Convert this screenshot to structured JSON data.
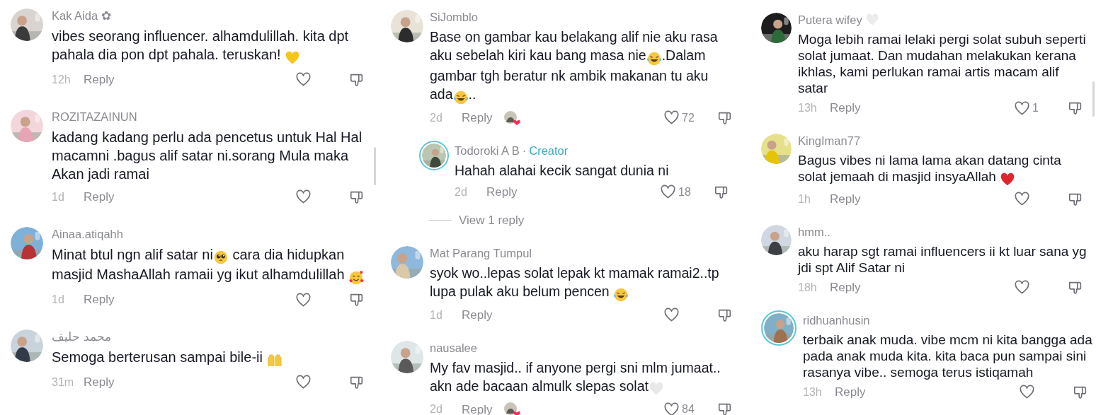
{
  "panels": [
    {
      "comments": [
        {
          "author": "Kak Aida ✿",
          "ring": false,
          "segments": [
            {
              "kind": "text",
              "text": "vibes seorang influencer. alhamdulillah. kita dpt pahala dia pon dpt pahala. teruskan! "
            },
            {
              "kind": "heart_emoji",
              "color": "#f5c518"
            }
          ],
          "time": "12h",
          "reply_label": "Reply",
          "creator_liked": false
        },
        {
          "author": "ROZITAZAINUN",
          "ring": false,
          "segments": [
            {
              "kind": "text",
              "text": "kadang kadang perlu ada pencetus untuk Hal Hal macamni .bagus alif satar ni.sorang Mula maka Akan jadi ramai"
            }
          ],
          "time": "1d",
          "reply_label": "Reply",
          "creator_liked": false
        },
        {
          "author": "Ainaa.atiqahh",
          "ring": false,
          "segments": [
            {
              "kind": "text",
              "text": "Minat btul ngn alif satar ni"
            },
            {
              "kind": "pleading_emoji"
            },
            {
              "kind": "text",
              "text": " cara dia hidupkan masjid MashaAllah ramaii yg ikut alhamdulillah "
            },
            {
              "kind": "hearts_emoji"
            }
          ],
          "time": "1d",
          "reply_label": "Reply",
          "creator_liked": false
        },
        {
          "author": "محمد حليف",
          "ring": false,
          "segments": [
            {
              "kind": "text",
              "text": "Semoga berterusan sampai bile-ii "
            },
            {
              "kind": "hands_emoji"
            }
          ],
          "time": "31m",
          "reply_label": "Reply",
          "creator_liked": false
        }
      ]
    },
    {
      "comments": [
        {
          "author": "SiJomblo",
          "ring": false,
          "segments": [
            {
              "kind": "text",
              "text": "Base on gambar kau belakang alif nie aku rasa aku sebelah kiri kau bang masa nie"
            },
            {
              "kind": "laugh_emoji"
            },
            {
              "kind": "text",
              "text": ".Dalam gambar tgh beratur nk ambik makanan tu aku ada"
            },
            {
              "kind": "laugh_emoji"
            },
            {
              "kind": "text",
              "text": ".."
            }
          ],
          "time": "2d",
          "reply_label": "Reply",
          "creator_liked": true,
          "likes": "72",
          "replies": [
            {
              "author": "Todoroki A B",
              "separator": "·",
              "badge": "Creator",
              "ring": true,
              "segments": [
                {
                  "kind": "text",
                  "text": "Hahah alahai kecik sangat dunia ni"
                }
              ],
              "time": "2d",
              "reply_label": "Reply",
              "creator_liked": false,
              "likes": "18"
            }
          ],
          "view_replies": "View 1 reply"
        },
        {
          "author": "Mat Parang Tumpul",
          "ring": false,
          "segments": [
            {
              "kind": "text",
              "text": "syok wo..lepas solat lepak kt mamak ramai2..tp lupa pulak aku belum pencen "
            },
            {
              "kind": "laugh_emoji"
            }
          ],
          "time": "1d",
          "reply_label": "Reply",
          "creator_liked": false
        },
        {
          "author": "nausalee",
          "ring": false,
          "segments": [
            {
              "kind": "text",
              "text": "My fav masjid.. if anyone pergi sni mlm jumaat.. akn ade bacaan almulk slepas solat"
            },
            {
              "kind": "heart_emoji",
              "color": "#e8e8e8"
            }
          ],
          "time": "2d",
          "reply_label": "Reply",
          "creator_liked": true,
          "likes": "84"
        }
      ]
    },
    {
      "comments": [
        {
          "author": "Putera wifey",
          "name_emoji": {
            "kind": "heart_emoji",
            "color": "#ececec"
          },
          "ring": false,
          "segments": [
            {
              "kind": "text",
              "text": "Moga lebih ramai lelaki pergi solat subuh seperti solat jumaat. Dan mudahan melakukan kerana ikhlas, kami perlukan ramai artis macam alif satar"
            }
          ],
          "time": "13h",
          "reply_label": "Reply",
          "creator_liked": false,
          "likes": "1"
        },
        {
          "author": "KingIman77",
          "ring": false,
          "segments": [
            {
              "kind": "text",
              "text": "Bagus vibes ni lama lama akan datang cinta solat jemaah di masjid insyaAllah "
            },
            {
              "kind": "heart_emoji",
              "color": "#e0252f"
            }
          ],
          "time": "1h",
          "reply_label": "Reply",
          "creator_liked": false
        },
        {
          "author": "hmm..",
          "ring": false,
          "segments": [
            {
              "kind": "text",
              "text": "aku harap sgt ramai influencers ii kt luar sana yg jdi spt Alif Satar ni"
            }
          ],
          "time": "18h",
          "reply_label": "Reply",
          "creator_liked": false
        },
        {
          "author": "ridhuanhusin",
          "ring": true,
          "segments": [
            {
              "kind": "text",
              "text": "terbaik anak muda. vibe mcm ni kita bangga ada pada anak muda kita. kita baca pun sampai sini rasanya vibe.. semoga terus istiqamah"
            }
          ],
          "time": "13h",
          "reply_label": "Reply",
          "creator_liked": false
        }
      ]
    }
  ]
}
